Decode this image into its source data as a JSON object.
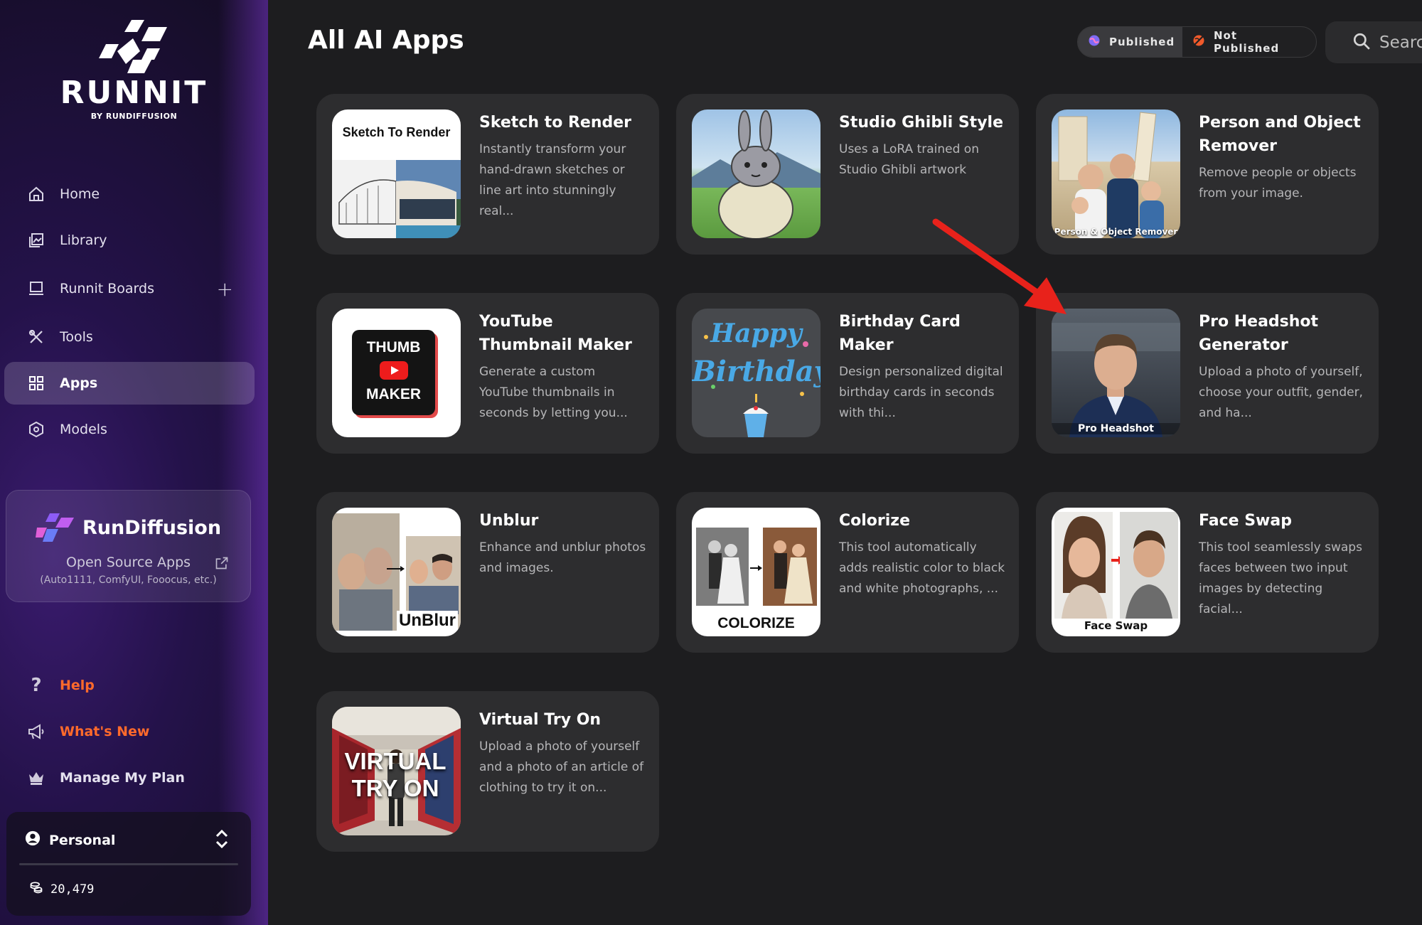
{
  "brand": {
    "name": "RUNNIT",
    "sub": "BY RUNDIFFUSION"
  },
  "nav": [
    {
      "label": "Home",
      "icon": "home-icon"
    },
    {
      "label": "Library",
      "icon": "library-icon"
    },
    {
      "label": "Runnit Boards",
      "icon": "boards-icon"
    },
    {
      "label": "Tools",
      "icon": "tools-icon"
    },
    {
      "label": "Apps",
      "icon": "apps-grid-icon",
      "selected": true
    },
    {
      "label": "Models",
      "icon": "models-icon"
    }
  ],
  "promo": {
    "title": "RunDiffusion",
    "subtitle": "Open Source Apps",
    "footnote": "(Auto1111, ComfyUI, Fooocus, etc.)"
  },
  "bottom_nav": [
    {
      "label": "Help",
      "icon": "question-icon"
    },
    {
      "label": "What's New",
      "icon": "megaphone-icon"
    },
    {
      "label": "Manage My Plan",
      "icon": "crown-icon"
    }
  ],
  "account": {
    "name": "Personal",
    "credits": "20,479"
  },
  "header": {
    "title": "All AI Apps",
    "published": "Published",
    "not_published": "Not Published",
    "search": "Search"
  },
  "apps": [
    {
      "title": "Sketch to Render",
      "desc": "Instantly transform your hand-drawn sketches or line art into stunningly real...",
      "thumb_label": "Sketch To Render"
    },
    {
      "title": "Studio Ghibli Style",
      "desc": "Uses a LoRA trained on Studio Ghibli artwork",
      "thumb_label": ""
    },
    {
      "title": "Person and Object Remover",
      "desc": "Remove people or objects from your image.",
      "thumb_label": "Person & Object Remover"
    },
    {
      "title": "YouTube Thumbnail Maker",
      "desc": "Generate a custom YouTube thumbnails in seconds by letting you...",
      "thumb_label": "THUMB MAKER"
    },
    {
      "title": "Birthday Card Maker",
      "desc": "Design personalized digital birthday cards in seconds with thi...",
      "thumb_label": "Happy Birthday"
    },
    {
      "title": "Pro Headshot Generator",
      "desc": "Upload a photo of yourself, choose your outfit, gender, and ha...",
      "thumb_label": "Pro Headshot"
    },
    {
      "title": "Unblur",
      "desc": "Enhance and unblur photos and images.",
      "thumb_label": "UnBlur"
    },
    {
      "title": "Colorize",
      "desc": "This tool automatically adds realistic color to black and white photographs, ...",
      "thumb_label": "COLORIZE"
    },
    {
      "title": "Face Swap",
      "desc": "This tool seamlessly swaps faces between two input images by detecting facial...",
      "thumb_label": "Face Swap"
    },
    {
      "title": "Virtual Try On",
      "desc": "Upload a photo of yourself and a photo of an article of clothing to try it on...",
      "thumb_label": "VIRTUAL TRY ON"
    }
  ],
  "colors": {
    "accent_orange": "#ff6a2b",
    "annotation_arrow": "#e8221b",
    "card_bg": "#2d2d2f"
  }
}
